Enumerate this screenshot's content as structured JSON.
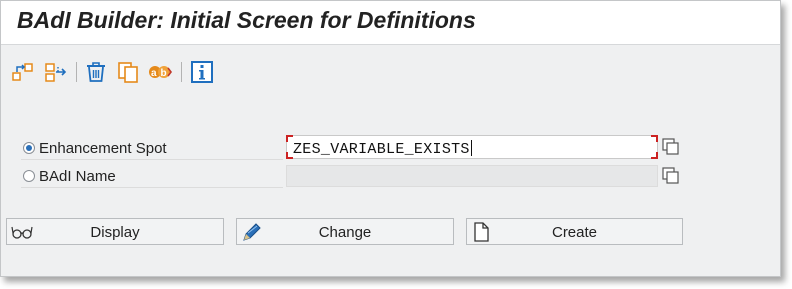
{
  "window": {
    "title": "BAdI Builder: Initial Screen for Definitions"
  },
  "toolbar": {
    "icons": [
      "other-object-icon",
      "where-used-icon",
      "delete-icon",
      "copy-icon",
      "rename-icon",
      "info-icon"
    ]
  },
  "form": {
    "enhancement_spot_label": "Enhancement Spot",
    "enhancement_spot_value": "ZES_VARIABLE_EXISTS",
    "badi_name_label": "BAdI Name",
    "badi_name_value": "",
    "selected": "enhancement_spot"
  },
  "actions": {
    "display_label": "Display",
    "change_label": "Change",
    "create_label": "Create"
  },
  "colors": {
    "window_bg": "#eff0f1",
    "required_marker": "#cc2222",
    "toolbar_icon_blue": "#1f6fbf",
    "toolbar_icon_orange": "#e58a1b"
  }
}
